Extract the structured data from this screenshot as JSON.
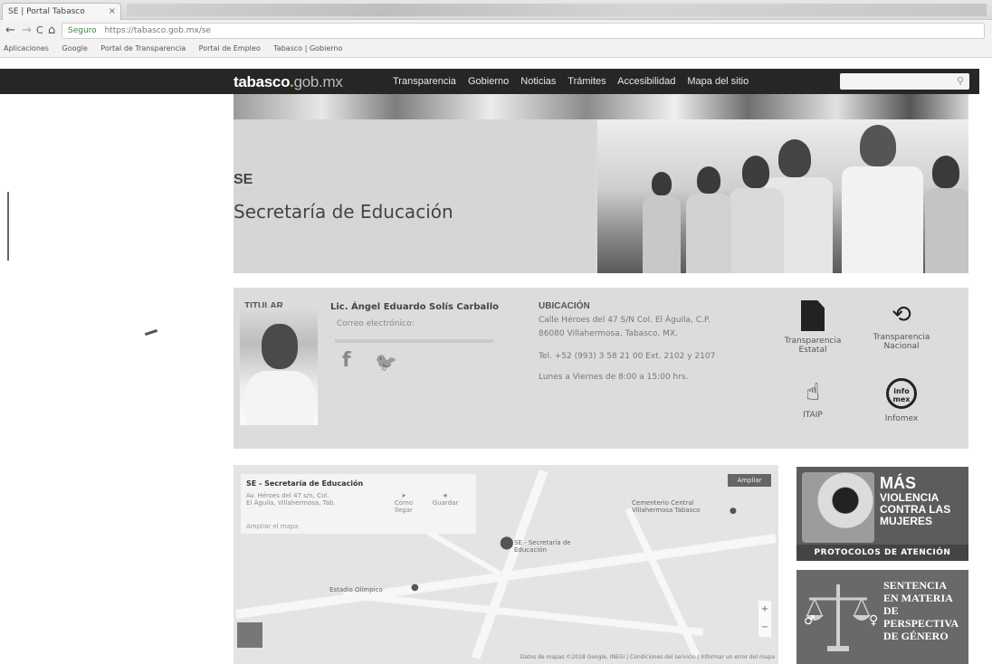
{
  "browser": {
    "tab_title": "SE | Portal Tabasco",
    "tab_close": "×",
    "back": "←",
    "forward": "→",
    "reload": "C",
    "home": "⌂",
    "secure_label": "Seguro",
    "url": "https://tabasco.gob.mx/se",
    "bookmarks": [
      "Aplicaciones",
      "Google",
      "Portal de Transparencia",
      "Portal de Empleo",
      "Tabasco | Gobierno"
    ]
  },
  "site": {
    "logo_main": "tabasco",
    "logo_dot": ".",
    "logo_gob": "gob.mx",
    "nav": [
      "Transparencia",
      "Gobierno",
      "Noticias",
      "Trámites",
      "Accesibilidad",
      "Mapa del sitio"
    ],
    "search_placeholder": ""
  },
  "hero": {
    "code": "SE",
    "name": "Secretaría de Educación"
  },
  "titular": {
    "label": "TITULAR",
    "name": "Lic. Ángel Eduardo Solís Carballo",
    "email_label": "Correo electrónico:",
    "facebook": "f",
    "twitter": "🐦"
  },
  "ubicacion": {
    "label": "UBICACIÓN",
    "lines": [
      "Calle Héroes del 47 S/N Col. El Águila, C.P.",
      "86080 Villahermosa, Tabasco, MX.",
      "Tel. +52 (993) 3 58 21 00 Ext. 2102 y 2107",
      "Lunes a Viernes de 8:00 a 15:00 hrs."
    ]
  },
  "links": [
    {
      "label1": "Transparencia",
      "label2": "Estatal"
    },
    {
      "label1": "Transparencia",
      "label2": "Nacional"
    },
    {
      "label1": "ITAIP",
      "label2": ""
    },
    {
      "label1": "Infomex",
      "label2": ""
    }
  ],
  "infomex_badge": "info mex",
  "map": {
    "card_title": "SE - Secretaría de Educación",
    "card_sub": "Av. Héroes del 47 s/n, Col. El Águila, Villahermosa, Tab.",
    "card_more": "Ampliar el mapa",
    "directions": "Cómo llegar",
    "save": "Guardar",
    "expand": "Ampliar",
    "poi_pin_label": "SE - Secretaría de Educación",
    "poi_cemetery": "Cementerio Central Villahermosa Tabasco",
    "poi_stadium": "Estadio Olímpico",
    "footer": "Datos de mapas ©2018 Google, INEGI | Condiciones del servicio | Informar un error del mapa",
    "zoom_in": "+",
    "zoom_out": "−"
  },
  "banner1": {
    "line1": "MÁS",
    "line2": "VIOLENCIA",
    "line3": "CONTRA LAS",
    "line4": "MUJERES",
    "footer": "PROTOCOLOS DE ATENCIÓN"
  },
  "banner2": {
    "line1": "SENTENCIA",
    "line2": "EN MATERIA",
    "line3": "DE PERSPECTIVA",
    "line4": "DE GÉNERO"
  }
}
